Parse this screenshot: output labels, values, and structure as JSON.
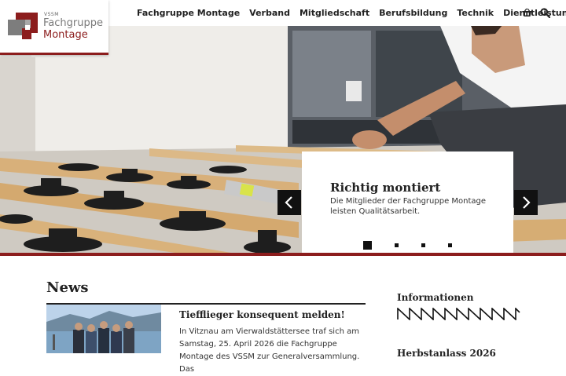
{
  "logo": {
    "org": "VSSM",
    "line1": "Fachgruppe",
    "line2": "Montage"
  },
  "nav": {
    "items": [
      {
        "label": "Fachgruppe Montage"
      },
      {
        "label": "Verband"
      },
      {
        "label": "Mitgliedschaft"
      },
      {
        "label": "Berufsbildung"
      },
      {
        "label": "Technik"
      },
      {
        "label": "Dienstleistungen"
      }
    ],
    "basket_icon": "basket-icon",
    "search_icon": "search-icon"
  },
  "hero": {
    "caption_title": "Richtig montiert",
    "caption_text": "Die Mitglieder der Fachgruppe Montage leisten Qualitätsarbeit.",
    "prev_icon": "chevron-left-icon",
    "next_icon": "chevron-right-icon",
    "slide_count": 4,
    "active_slide": 1
  },
  "news": {
    "section_title": "News",
    "article_title": "Tiefflieger konsequent melden!",
    "article_body": "In Vitznau am Vierwaldstättersee traf sich am Samstag, 25. April 2026 die Fachgruppe Montage des VSSM zur Generalversammlung. Das"
  },
  "sidebar": {
    "info_title": "Informationen",
    "next_title": "Herbstanlass 2026"
  },
  "colors": {
    "brand_red": "#8c1d1d",
    "text": "#222222"
  }
}
